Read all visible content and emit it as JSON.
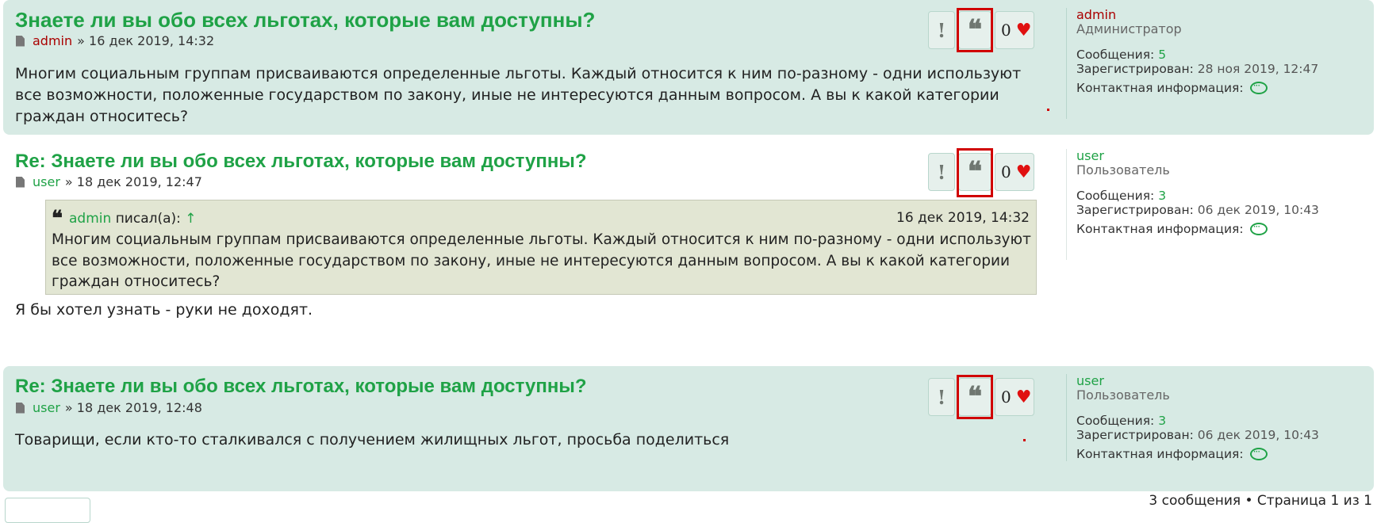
{
  "posts": [
    {
      "title": "Знаете ли вы обо всех льготах, которые вам доступны?",
      "author": "admin",
      "datetime_sep": "»",
      "datetime": "16 дек 2019, 14:32",
      "body": "Многим социальным группам присваиваются определенные льготы. Каждый относится к ним по-разному - одни используют все возможности, положенные государством по закону, иные не интересуются данным вопросом. А вы к какой категории граждан относитесь?",
      "likes": "0",
      "profile": {
        "username": "admin",
        "rank": "Администратор",
        "posts_label": "Сообщения:",
        "posts_count": "5",
        "registered_label": "Зарегистрирован:",
        "registered": "28 ноя 2019, 12:47",
        "contact_label": "Контактная информация:"
      }
    },
    {
      "title": "Re: Знаете ли вы обо всех льготах, которые вам доступны?",
      "author": "user",
      "datetime_sep": "»",
      "datetime": "18 дек 2019, 12:47",
      "quote": {
        "author": "admin",
        "wrote": "писал(а):",
        "arrow": "↑",
        "date": "16 дек 2019, 14:32",
        "text": "Многим социальным группам присваиваются определенные льготы. Каждый относится к ним по-разному - одни используют все возможности, положенные государством по закону, иные не интересуются данным вопросом. А вы к какой категории граждан относитесь?"
      },
      "body": "Я бы хотел узнать - руки не доходят.",
      "likes": "0",
      "profile": {
        "username": "user",
        "rank": "Пользователь",
        "posts_label": "Сообщения:",
        "posts_count": "3",
        "registered_label": "Зарегистрирован:",
        "registered": "06 дек 2019, 10:43",
        "contact_label": "Контактная информация:"
      }
    },
    {
      "title": "Re: Знаете ли вы обо всех льготах, которые вам доступны?",
      "author": "user",
      "datetime_sep": "»",
      "datetime": "18 дек 2019, 12:48",
      "body": "Товарищи, если кто-то сталкивался с получением жилищных льгот, просьба поделиться",
      "likes": "0",
      "profile": {
        "username": "user",
        "rank": "Пользователь",
        "posts_label": "Сообщения:",
        "posts_count": "3",
        "registered_label": "Зарегистрирован:",
        "registered": "06 дек 2019, 10:43",
        "contact_label": "Контактная информация:"
      }
    }
  ],
  "icons": {
    "report": "!",
    "quote": "❝",
    "heart": "♥"
  },
  "footer": {
    "summary": "3 сообщения • Страница 1 из 1"
  },
  "colors": {
    "accent_green": "#1fa246",
    "admin_red": "#aa0000",
    "post_bg": "#d7eae4",
    "highlight": "#d00000",
    "like_heart": "#e01010"
  }
}
